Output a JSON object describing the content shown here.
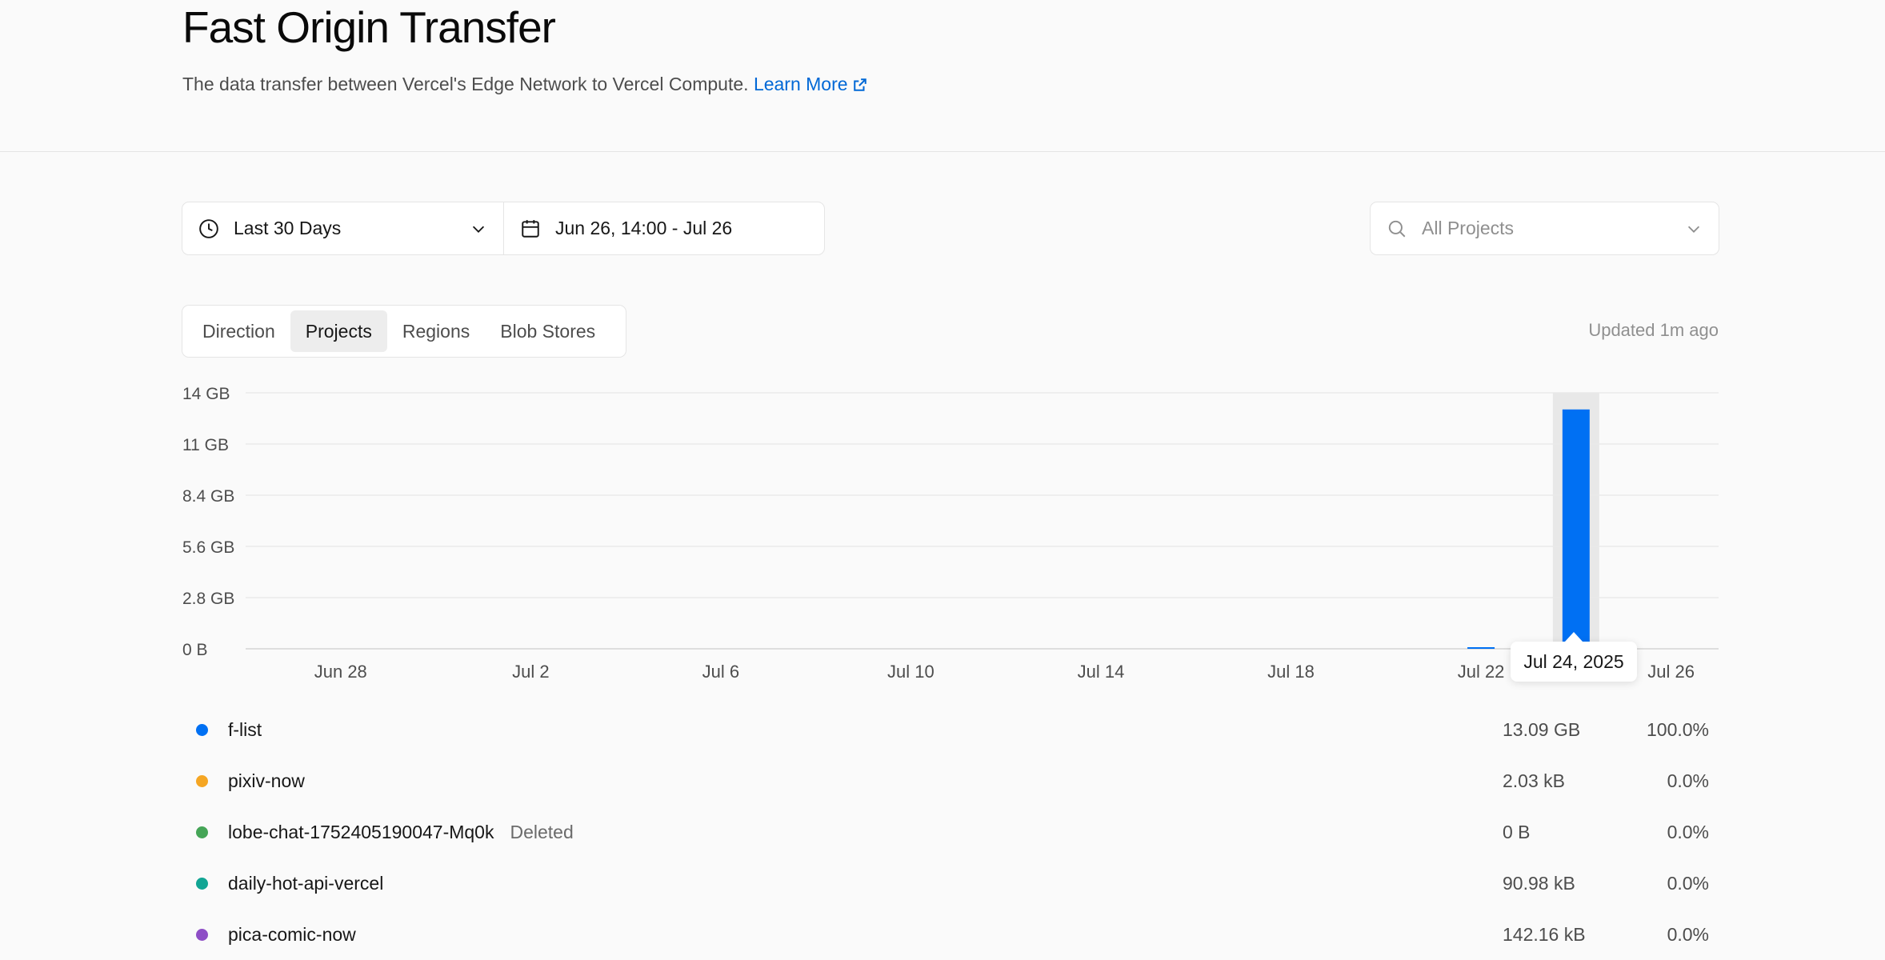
{
  "header": {
    "title": "Fast Origin Transfer",
    "description": "The data transfer between Vercel's Edge Network to Vercel Compute.",
    "learn_more": "Learn More"
  },
  "filters": {
    "range_label": "Last 30 Days",
    "date_range": "Jun 26, 14:00 - Jul 26",
    "project_placeholder": "All Projects"
  },
  "tabs": [
    {
      "label": "Direction",
      "active": false
    },
    {
      "label": "Projects",
      "active": true
    },
    {
      "label": "Regions",
      "active": false
    },
    {
      "label": "Blob Stores",
      "active": false
    }
  ],
  "updated": "Updated 1m ago",
  "tooltip": "Jul 24, 2025",
  "icons": [
    "clock-icon",
    "chevron-down-icon",
    "calendar-icon",
    "search-icon",
    "external-link-icon"
  ],
  "colors": {
    "accent": "#0070f3",
    "link": "#0068d6",
    "highlight": "#e8e8e8"
  },
  "chart_data": {
    "type": "bar",
    "y_ticks": [
      "14 GB",
      "11 GB",
      "8.4 GB",
      "5.6 GB",
      "2.8 GB",
      "0 B"
    ],
    "x_ticks": [
      "Jun 28",
      "Jul 2",
      "Jul 6",
      "Jul 10",
      "Jul 14",
      "Jul 18",
      "Jul 22",
      "Jul 26"
    ],
    "ylim_gb": [
      0,
      14
    ],
    "x_range": [
      "Jun 26",
      "Jul 27"
    ],
    "grid": true,
    "series": [
      {
        "name": "f-list",
        "color": "#0070f3",
        "points": [
          {
            "x": "Jul 22",
            "y_gb": 0.05
          },
          {
            "x": "Jul 24",
            "y_gb": 13.09
          }
        ]
      }
    ],
    "highlight": "Jul 24"
  },
  "legend": [
    {
      "name": "f-list",
      "badge": "",
      "value": "13.09 GB",
      "pct": "100.0%",
      "color": "#0070f3"
    },
    {
      "name": "pixiv-now",
      "badge": "",
      "value": "2.03 kB",
      "pct": "0.0%",
      "color": "#f5a623"
    },
    {
      "name": "lobe-chat-1752405190047-Mq0k",
      "badge": "Deleted",
      "value": "0 B",
      "pct": "0.0%",
      "color": "#45a557"
    },
    {
      "name": "daily-hot-api-vercel",
      "badge": "",
      "value": "90.98 kB",
      "pct": "0.0%",
      "color": "#12a594"
    },
    {
      "name": "pica-comic-now",
      "badge": "",
      "value": "142.16 kB",
      "pct": "0.0%",
      "color": "#8e4ec6"
    }
  ]
}
